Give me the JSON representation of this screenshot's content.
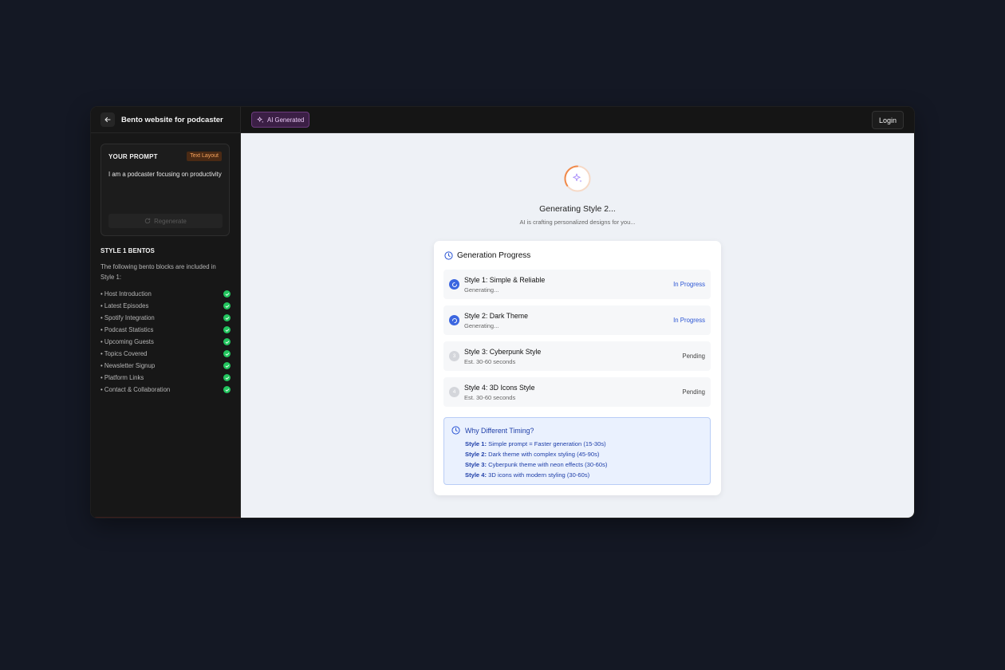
{
  "sidebar": {
    "project_title": "Bento website for podcaster",
    "prompt_label": "YOUR PROMPT",
    "layout_badge": "Text Layout",
    "prompt_text": "I am a podcaster focusing on productivity",
    "regenerate_label": "Regenerate",
    "bentos_title": "STYLE 1 BENTOS",
    "bentos_description": "The following bento blocks are included in Style 1:",
    "bento_items": [
      "• Host Introduction",
      "• Latest Episodes",
      "• Spotify Integration",
      "• Podcast Statistics",
      "• Upcoming Guests",
      "• Topics Covered",
      "• Newsletter Signup",
      "• Platform Links",
      "• Contact & Collaboration"
    ]
  },
  "topbar": {
    "ai_badge": "AI Generated",
    "login_label": "Login"
  },
  "main": {
    "generating_title": "Generating Style 2...",
    "generating_subtitle": "AI is crafting personalized designs for you...",
    "progress_title": "Generation Progress",
    "steps": [
      {
        "name": "Style 1: Simple & Reliable",
        "detail": "Generating...",
        "status": "In Progress",
        "state": "active",
        "number": "1"
      },
      {
        "name": "Style 2: Dark Theme",
        "detail": "Generating...",
        "status": "In Progress",
        "state": "active",
        "number": "2"
      },
      {
        "name": "Style 3: Cyberpunk Style",
        "detail": "Est. 30-60 seconds",
        "status": "Pending",
        "state": "pending",
        "number": "3"
      },
      {
        "name": "Style 4: 3D Icons Style",
        "detail": "Est. 30-60 seconds",
        "status": "Pending",
        "state": "pending",
        "number": "4"
      }
    ],
    "timing": {
      "title": "Why Different Timing?",
      "lines": [
        {
          "label": "Style 1:",
          "text": " Simple prompt = Faster generation (15-30s)"
        },
        {
          "label": "Style 2:",
          "text": " Dark theme with complex styling (45-90s)"
        },
        {
          "label": "Style 3:",
          "text": " Cyberpunk theme with neon effects (30-60s)"
        },
        {
          "label": "Style 4:",
          "text": " 3D icons with modern styling (30-60s)"
        }
      ]
    }
  },
  "icons": [
    "arrow-left-icon",
    "refresh-icon",
    "check-circle-icon",
    "sparkles-icon",
    "clock-icon",
    "spinner-icon"
  ],
  "colors": {
    "accent_blue": "#3b66e0",
    "success_green": "#22c55e",
    "ai_purple": "#6b3a7d",
    "spinner_orange": "#f08a4b",
    "badge_orange": "#f6a45e"
  }
}
